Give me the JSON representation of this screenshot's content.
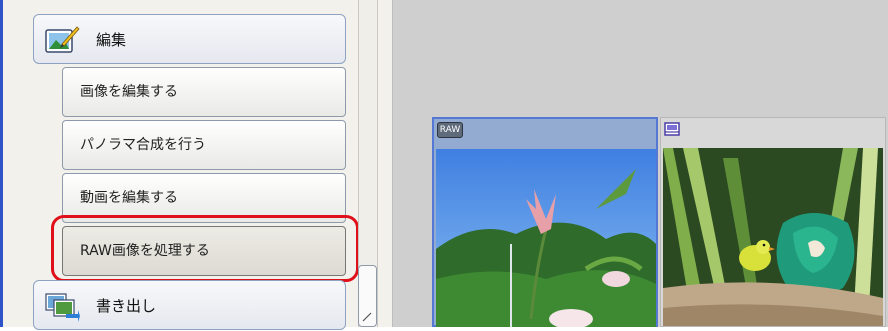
{
  "task_panel": {
    "groups": [
      {
        "label": "編集",
        "icon": "edit-image-icon"
      },
      {
        "label": "書き出し",
        "icon": "export-images-icon"
      }
    ],
    "tasks": [
      {
        "label": "画像を編集する"
      },
      {
        "label": "パノラマ合成を行う"
      },
      {
        "label": "動画を編集する"
      },
      {
        "label": "RAW画像を処理する",
        "selected": true
      }
    ]
  },
  "viewer": {
    "thumbnails": [
      {
        "badge": "RAW",
        "badge_type": "raw",
        "subject": "pink-flower-photo",
        "selected": true
      },
      {
        "badge": "",
        "badge_type": "movie",
        "subject": "bird-photo",
        "selected": false
      }
    ]
  },
  "colors": {
    "highlight": "#e0101a",
    "panel_edge": "#2f54c7",
    "selection": "#5478d4",
    "viewer_bg": "#cfcfcf"
  }
}
